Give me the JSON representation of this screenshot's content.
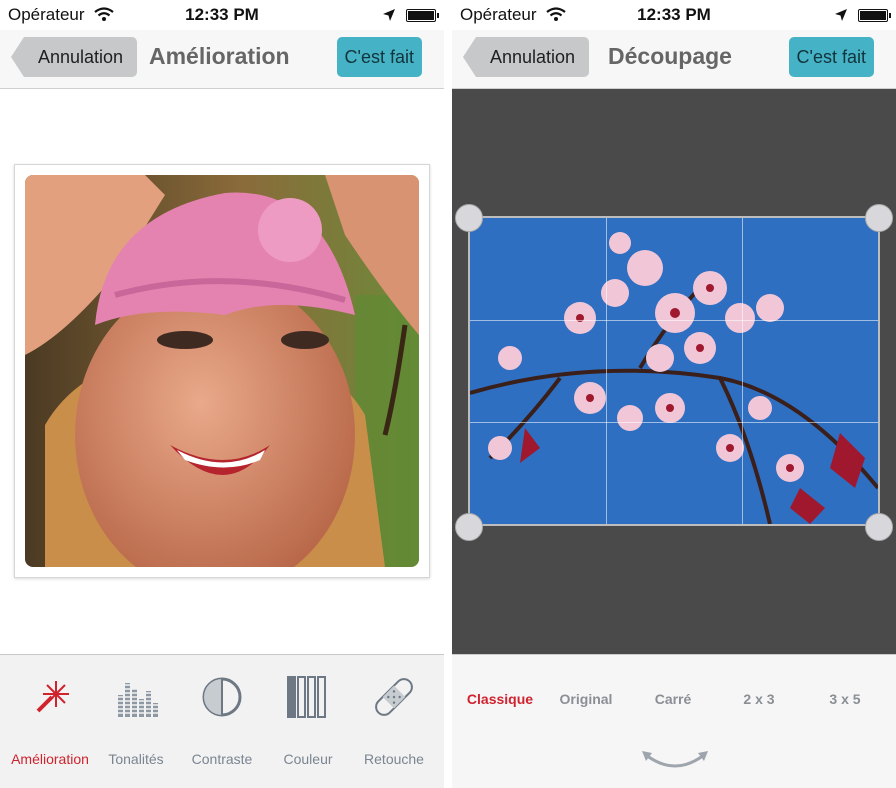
{
  "status": {
    "carrier": "Opérateur",
    "time": "12:33 PM"
  },
  "left": {
    "nav": {
      "back": "Annulation",
      "title": "Amélioration",
      "done": "C'est fait"
    },
    "tools": [
      {
        "label": "Amélioration",
        "icon": "magic-wand-icon",
        "active": true
      },
      {
        "label": "Tonalités",
        "icon": "equalizer-icon",
        "active": false
      },
      {
        "label": "Contraste",
        "icon": "contrast-icon",
        "active": false
      },
      {
        "label": "Couleur",
        "icon": "color-bars-icon",
        "active": false
      },
      {
        "label": "Retouche",
        "icon": "bandage-icon",
        "active": false
      }
    ]
  },
  "right": {
    "nav": {
      "back": "Annulation",
      "title": "Découpage",
      "done": "C'est fait"
    },
    "ratios": [
      {
        "label": "Classique",
        "active": true
      },
      {
        "label": "Original",
        "active": false
      },
      {
        "label": "Carré",
        "active": false
      },
      {
        "label": "2 x 3",
        "active": false
      },
      {
        "label": "3 x 5",
        "active": false
      }
    ]
  },
  "colors": {
    "accent": "#d0232e",
    "done": "#45b2c5",
    "crop_background": "#4a4a4a",
    "sky": "#2e6fc2"
  }
}
